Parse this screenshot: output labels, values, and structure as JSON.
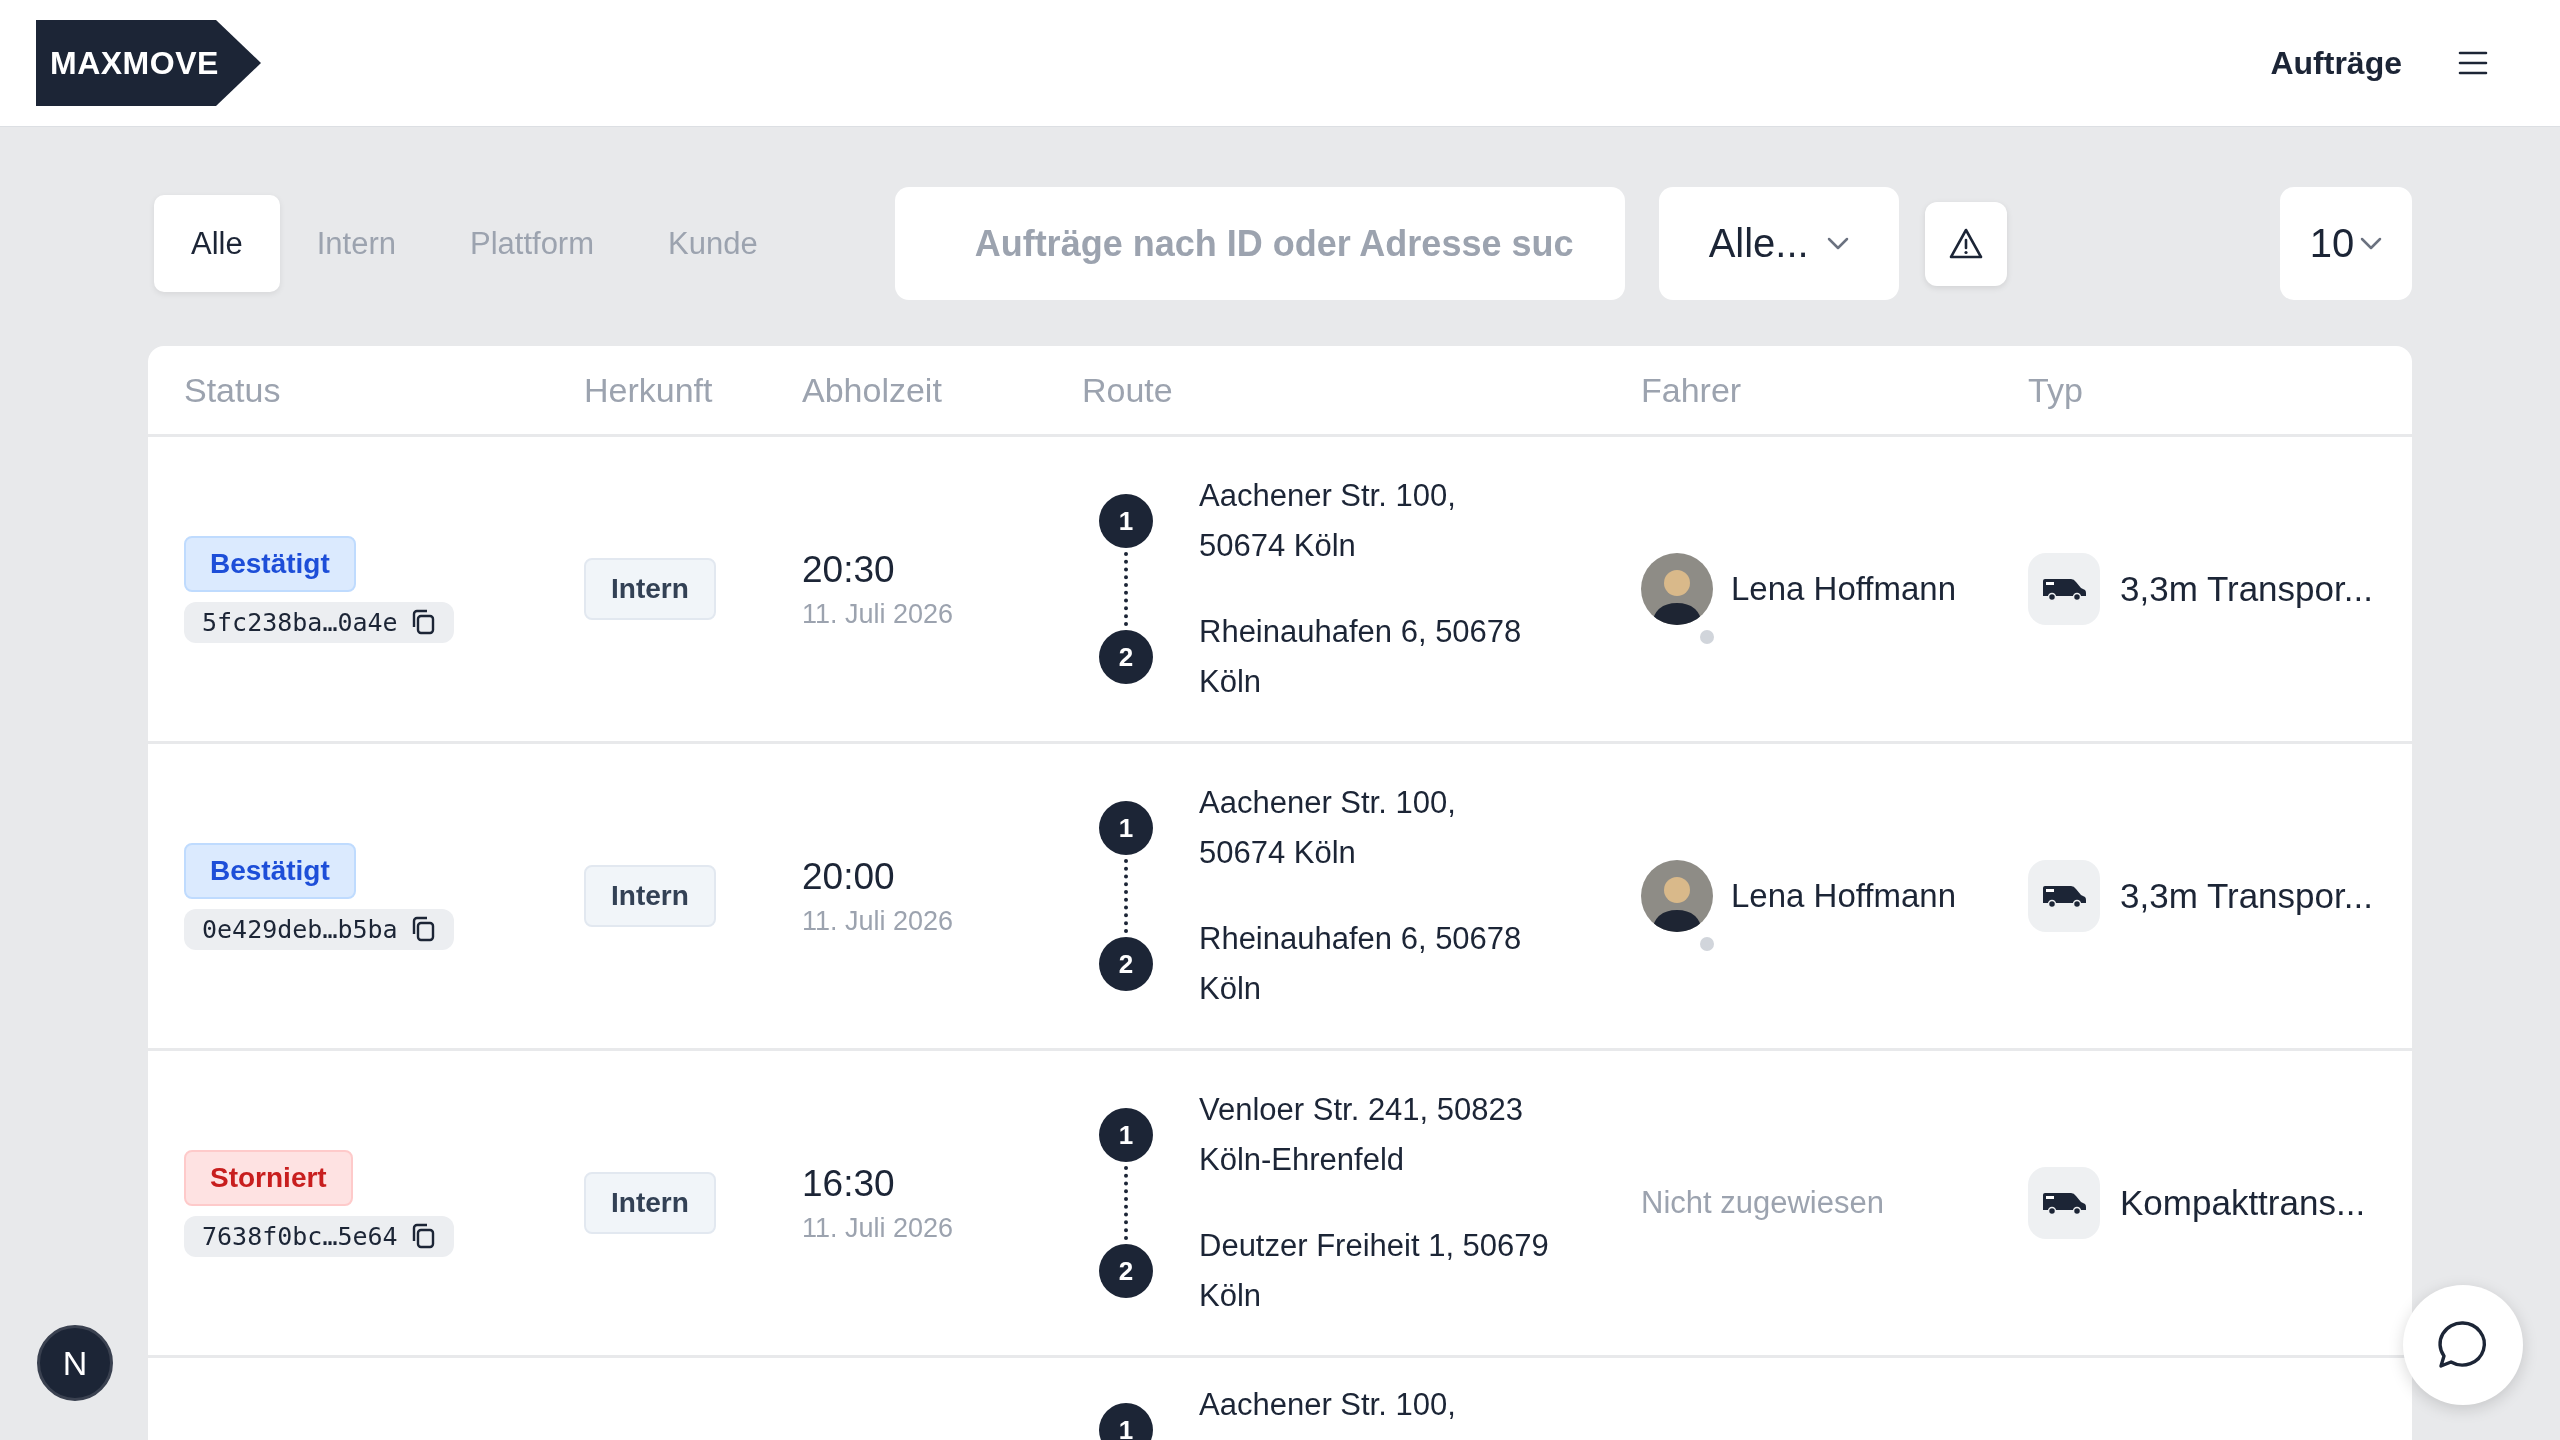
{
  "header": {
    "logo": "MAXMOVE",
    "nav_link": "Aufträge"
  },
  "filters": {
    "tabs": [
      {
        "label": "Alle",
        "selected": true
      },
      {
        "label": "Intern",
        "selected": false
      },
      {
        "label": "Plattform",
        "selected": false
      },
      {
        "label": "Kunde",
        "selected": false
      }
    ],
    "search": {
      "placeholder": "Aufträge nach ID oder Adresse suc"
    },
    "status_select": {
      "value": "Alle..."
    },
    "page_size": {
      "value": "10"
    }
  },
  "table": {
    "columns": [
      "Status",
      "Herkunft",
      "Abholzeit",
      "Route",
      "Fahrer",
      "Typ"
    ],
    "rows": [
      {
        "status": {
          "label": "Bestätigt",
          "kind": "confirmed"
        },
        "id": "5fc238ba…0a4e",
        "origin": "Intern",
        "time": "20:30",
        "date": "11. Juli 2026",
        "stops": [
          {
            "number": "1",
            "address_lines": [
              "Aachener Str. 100,",
              "50674 Köln"
            ]
          },
          {
            "number": "2",
            "address_lines": [
              "Rheinauhafen 6, 50678",
              "Köln"
            ]
          }
        ],
        "driver": {
          "name": "Lena Hoffmann",
          "online": false
        },
        "vehicle": "3,3m Transpor..."
      },
      {
        "status": {
          "label": "Bestätigt",
          "kind": "confirmed"
        },
        "id": "0e429deb…b5ba",
        "origin": "Intern",
        "time": "20:00",
        "date": "11. Juli 2026",
        "stops": [
          {
            "number": "1",
            "address_lines": [
              "Aachener Str. 100,",
              "50674 Köln"
            ]
          },
          {
            "number": "2",
            "address_lines": [
              "Rheinauhafen 6, 50678",
              "Köln"
            ]
          }
        ],
        "driver": {
          "name": "Lena Hoffmann",
          "online": false
        },
        "vehicle": "3,3m Transpor..."
      },
      {
        "status": {
          "label": "Storniert",
          "kind": "cancelled"
        },
        "id": "7638f0bc…5e64",
        "origin": "Intern",
        "time": "16:30",
        "date": "11. Juli 2026",
        "stops": [
          {
            "number": "1",
            "address_lines": [
              "Venloer Str. 241, 50823",
              "Köln-Ehrenfeld"
            ]
          },
          {
            "number": "2",
            "address_lines": [
              "Deutzer Freiheit 1, 50679",
              "Köln"
            ]
          }
        ],
        "driver_placeholder": "Nicht zugewiesen",
        "vehicle": "Kompakttrans..."
      },
      {
        "stops": [
          {
            "number": "1",
            "address_lines": [
              "Aachener Str. 100,"
            ]
          }
        ]
      }
    ]
  },
  "corner_badge": "N"
}
